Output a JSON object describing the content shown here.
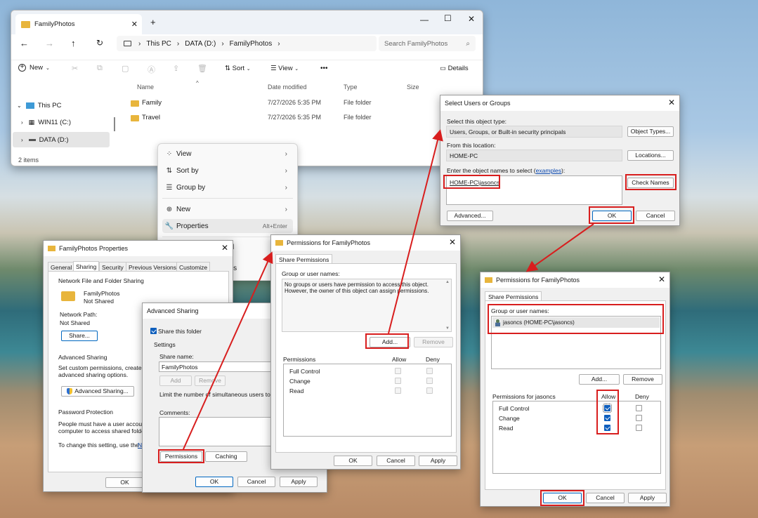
{
  "explorer": {
    "tab_title": "FamilyPhotos",
    "new_tab": "+",
    "address": [
      "This PC",
      "DATA (D:)",
      "FamilyPhotos"
    ],
    "search_placeholder": "Search FamilyPhotos",
    "toolbar": {
      "new": "New",
      "sort": "Sort",
      "view": "View",
      "details": "Details",
      "more": "•••"
    },
    "columns": [
      "Name",
      "Date modified",
      "Type",
      "Size"
    ],
    "rows": [
      {
        "name": "Family",
        "date": "7/27/2026 5:35 PM",
        "type": "File folder"
      },
      {
        "name": "Travel",
        "date": "7/27/2026 5:35 PM",
        "type": "File folder"
      }
    ],
    "nav": [
      "This PC",
      "WIN11 (C:)",
      "DATA (D:)"
    ],
    "status": "2 items"
  },
  "context_menu": {
    "items": [
      {
        "label": "View",
        "icon": "grid-icon"
      },
      {
        "label": "Sort by",
        "icon": "sort-icon"
      },
      {
        "label": "Group by",
        "icon": "list-icon"
      },
      {
        "label": "New",
        "icon": "plus-circle-icon"
      },
      {
        "label": "Properties",
        "icon": "wrench-icon",
        "shortcut": "Alt+Enter"
      }
    ],
    "partial": [
      "l",
      "ons"
    ]
  },
  "properties": {
    "title": "FamilyPhotos Properties",
    "tabs": [
      "General",
      "Sharing",
      "Security",
      "Previous Versions",
      "Customize"
    ],
    "group1": "Network File and Folder Sharing",
    "folder_name": "FamilyPhotos",
    "folder_state": "Not Shared",
    "network_path_label": "Network Path:",
    "network_path": "Not Shared",
    "share_button": "Share...",
    "group2": "Advanced Sharing",
    "adv_text1": "Set custom permissions, create m",
    "adv_text2": "advanced sharing options.",
    "adv_button": "Advanced Sharing...",
    "group3": "Password Protection",
    "pw_text1": "People must have a user account",
    "pw_text2": "computer to access shared folder",
    "pw_text3": "To change this setting, use the",
    "pw_link": "N",
    "ok": "OK"
  },
  "advanced_sharing": {
    "title": "Advanced Sharing",
    "share_check": "Share this folder",
    "settings": "Settings",
    "share_name_label": "Share name:",
    "share_name": "FamilyPhotos",
    "add": "Add",
    "remove": "Remove",
    "limit": "Limit the number of simultaneous users to:",
    "comments": "Comments:",
    "permissions": "Permissions",
    "caching": "Caching",
    "ok": "OK",
    "cancel": "Cancel",
    "apply": "Apply"
  },
  "perm1": {
    "title": "Permissions for FamilyPhotos",
    "tab": "Share Permissions",
    "group_label": "Group or user names:",
    "empty_msg1": "No groups or users have permission to access this object.",
    "empty_msg2": "However, the owner of this object can assign permissions.",
    "add": "Add...",
    "remove": "Remove",
    "perm_label": "Permissions",
    "allow": "Allow",
    "deny": "Deny",
    "perms": [
      "Full Control",
      "Change",
      "Read"
    ],
    "ok": "OK",
    "cancel": "Cancel",
    "apply": "Apply"
  },
  "select_users": {
    "title": "Select Users or Groups",
    "type_label": "Select this object type:",
    "type_value": "Users, Groups, or Built-in security principals",
    "object_types": "Object Types...",
    "loc_label": "From this location:",
    "loc_value": "HOME-PC",
    "locations": "Locations...",
    "enter_label": "Enter the object names to select (",
    "examples": "examples",
    "enter_suffix": "):",
    "name_value": "HOME-PC\\jasoncs",
    "check_names": "Check Names",
    "advanced": "Advanced...",
    "ok": "OK",
    "cancel": "Cancel"
  },
  "perm2": {
    "title": "Permissions for FamilyPhotos",
    "tab": "Share Permissions",
    "group_label": "Group or user names:",
    "user": "jasoncs (HOME-PC\\jasoncs)",
    "add": "Add...",
    "remove": "Remove",
    "perm_label": "Permissions for jasoncs",
    "allow": "Allow",
    "deny": "Deny",
    "perms": [
      "Full Control",
      "Change",
      "Read"
    ],
    "ok": "OK",
    "cancel": "Cancel",
    "apply": "Apply"
  },
  "colors": {
    "annotation": "#d81e1e",
    "accent": "#0f5fbd",
    "folder": "#e8b53c"
  }
}
